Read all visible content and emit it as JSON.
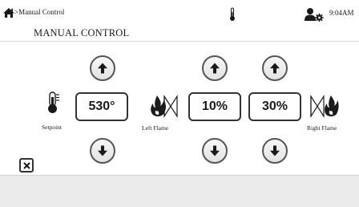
{
  "header": {
    "breadcrumb": ">Manual Control",
    "title": "MANUAL CONTROL",
    "time": "9:04AM",
    "icons": [
      "home-icon",
      "thermometer-icon",
      "user-settings-icon"
    ]
  },
  "setpoint": {
    "value": "530°",
    "label": "Setpoint",
    "icon": "thermometer-icon"
  },
  "left_flame": {
    "value": "10%",
    "label": "Left Flame",
    "icon": "flame-valve-icon"
  },
  "right_flame": {
    "value": "30%",
    "label": "Right Flame",
    "icon": "flame-valve-icon"
  },
  "controls": {
    "up_icon": "arrow-up-icon",
    "down_icon": "arrow-down-icon",
    "close_icon": "close-icon"
  },
  "colors": {
    "background": "#ffffff",
    "footer": "#ebebeb",
    "button_border": "#555555",
    "text": "#1a1a1a"
  }
}
